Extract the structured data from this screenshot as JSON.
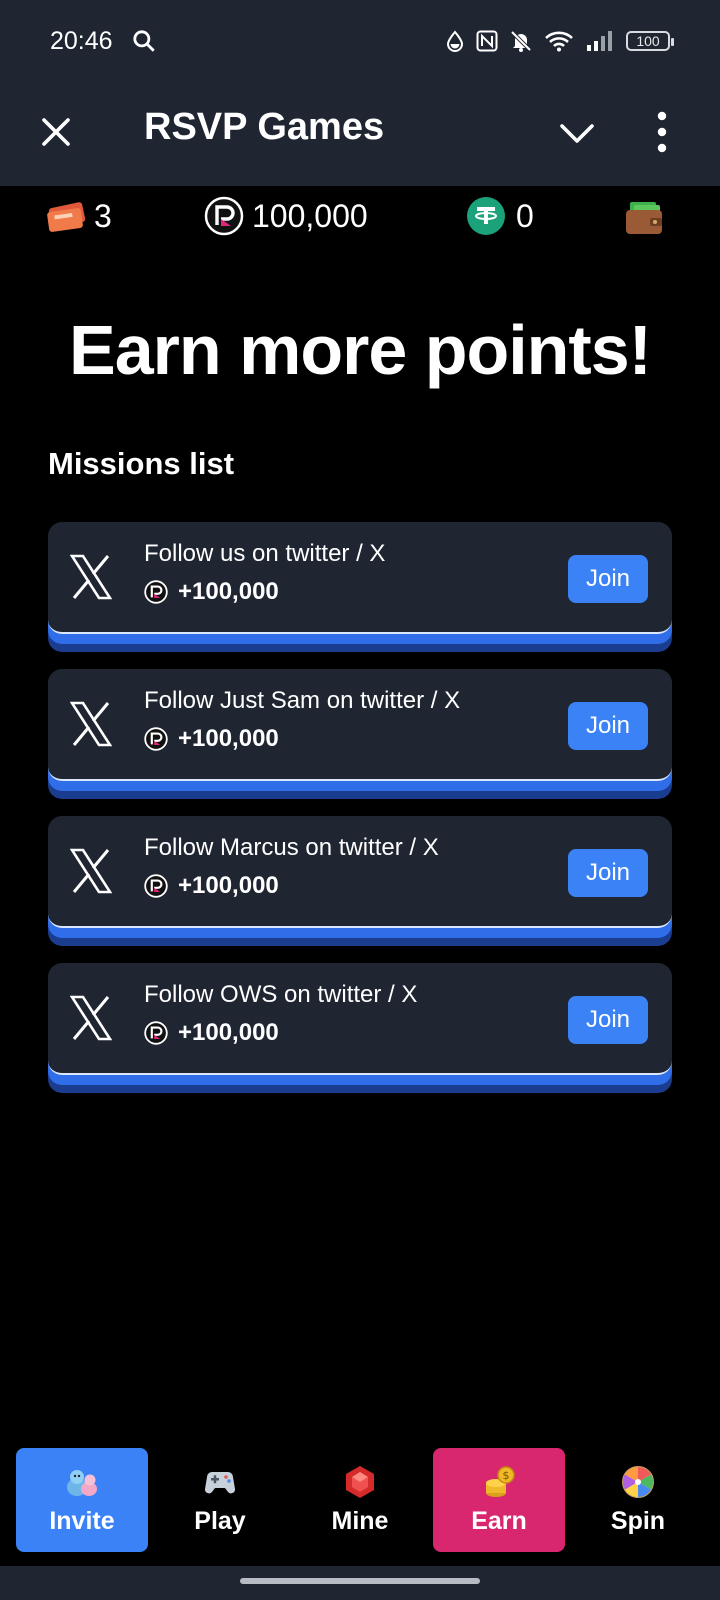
{
  "status_bar": {
    "time": "20:46",
    "battery": "100"
  },
  "header": {
    "title": "RSVP Games"
  },
  "balances": {
    "tickets": "3",
    "points": "100,000",
    "usdt": "0"
  },
  "headline": "Earn more points!",
  "missions_title": "Missions list",
  "missions": [
    {
      "title": "Follow us on twitter / X",
      "reward": "+100,000",
      "button": "Join"
    },
    {
      "title": "Follow Just Sam on twitter / X",
      "reward": "+100,000",
      "button": "Join"
    },
    {
      "title": "Follow Marcus on twitter / X",
      "reward": "+100,000",
      "button": "Join"
    },
    {
      "title": "Follow OWS on twitter / X",
      "reward": "+100,000",
      "button": "Join"
    }
  ],
  "nav": {
    "invite": "Invite",
    "play": "Play",
    "mine": "Mine",
    "earn": "Earn",
    "spin": "Spin"
  },
  "colors": {
    "header_bg": "#1f2632",
    "accent_blue": "#3b82f6",
    "earn_pink": "#d8266f",
    "usdt_green": "#1ba27a"
  },
  "icons": [
    "search-icon",
    "water-drop-icon",
    "nfc-icon",
    "bell-off-icon",
    "wifi-icon",
    "signal-icon",
    "close-icon",
    "chevron-down-icon",
    "more-vertical-icon",
    "ticket-icon",
    "points-coin-icon",
    "usdt-icon",
    "wallet-icon",
    "x-logo-icon",
    "invite-icon",
    "gamepad-icon",
    "gem-icon",
    "coins-icon",
    "wheel-icon"
  ]
}
